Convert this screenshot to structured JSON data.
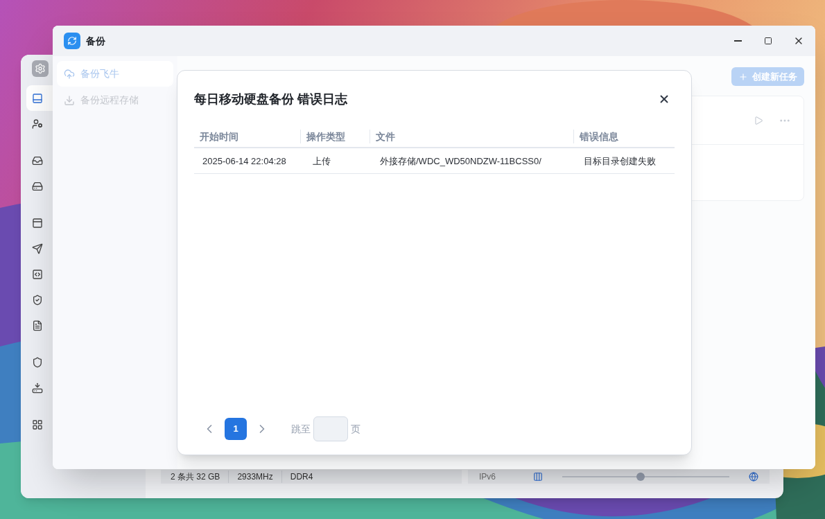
{
  "back_window": {
    "sidebar": {
      "groups": [
        {
          "items": [
            {
              "selected": true
            },
            {
              "selected": false
            }
          ]
        },
        {
          "items": [
            {
              "selected": false
            },
            {
              "selected": false
            }
          ]
        },
        {
          "items": [
            {
              "selected": false
            },
            {
              "selected": false
            },
            {
              "selected": false
            },
            {
              "selected": false
            },
            {
              "selected": false
            }
          ]
        },
        {
          "items": [
            {
              "selected": false
            },
            {
              "selected": false
            }
          ]
        },
        {
          "items": [
            {
              "selected": false
            }
          ]
        }
      ]
    },
    "memory_info": [
      "2 条共 32 GB",
      "2933MHz",
      "DDR4"
    ],
    "network": {
      "label": "IPv6",
      "level": 0.47
    }
  },
  "window": {
    "title": "备份",
    "sidebar": {
      "items": [
        {
          "label": "备份飞牛",
          "selected": true
        },
        {
          "label": "备份远程存储",
          "selected": false
        }
      ]
    },
    "create_button": "创建新任务",
    "modal": {
      "title": "每日移动硬盘备份 错误日志",
      "columns": [
        "开始时间",
        "操作类型",
        "文件",
        "错误信息"
      ],
      "rows": [
        [
          "2025-06-14 22:04:28",
          "上传",
          "外接存储/WDC_WD50NDZW-11BCSS0/",
          "目标目录创建失败"
        ]
      ],
      "pagination": {
        "pages": [
          {
            "label": "1",
            "selected": true
          }
        ],
        "jump_label": "跳至",
        "page_suffix": "页"
      }
    }
  }
}
